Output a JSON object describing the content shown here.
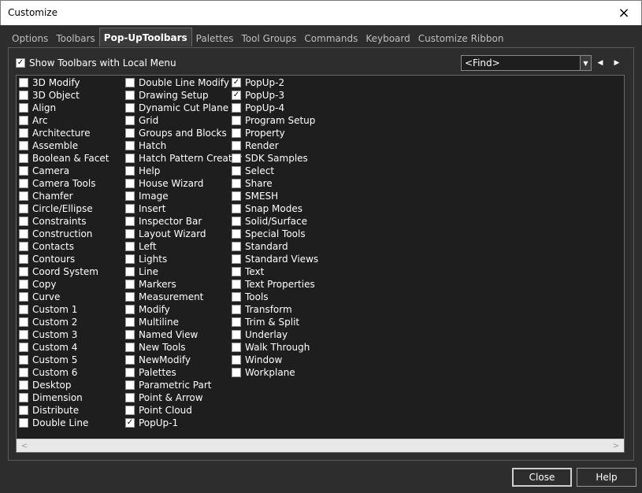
{
  "window": {
    "title": "Customize"
  },
  "tabs": [
    {
      "label": "Options",
      "active": false
    },
    {
      "label": "Toolbars",
      "active": false
    },
    {
      "label": "Pop-UpToolbars",
      "active": true
    },
    {
      "label": "Palettes",
      "active": false
    },
    {
      "label": "Tool Groups",
      "active": false
    },
    {
      "label": "Commands",
      "active": false
    },
    {
      "label": "Keyboard",
      "active": false
    },
    {
      "label": "Customize Ribbon",
      "active": false
    }
  ],
  "show_local_menu": {
    "label": "Show Toolbars with Local Menu",
    "checked": true
  },
  "find": {
    "value": "<Find>"
  },
  "columns": [
    [
      {
        "label": "3D Modify",
        "checked": false
      },
      {
        "label": "3D Object",
        "checked": false
      },
      {
        "label": "Align",
        "checked": false
      },
      {
        "label": "Arc",
        "checked": false
      },
      {
        "label": "Architecture",
        "checked": false
      },
      {
        "label": "Assemble",
        "checked": false
      },
      {
        "label": "Boolean & Facet",
        "checked": false
      },
      {
        "label": "Camera",
        "checked": false
      },
      {
        "label": "Camera Tools",
        "checked": false
      },
      {
        "label": "Chamfer",
        "checked": false
      },
      {
        "label": "Circle/Ellipse",
        "checked": false
      },
      {
        "label": "Constraints",
        "checked": false
      },
      {
        "label": "Construction",
        "checked": false
      },
      {
        "label": "Contacts",
        "checked": false
      },
      {
        "label": "Contours",
        "checked": false
      },
      {
        "label": "Coord System",
        "checked": false
      },
      {
        "label": "Copy",
        "checked": false
      },
      {
        "label": "Curve",
        "checked": false
      },
      {
        "label": "Custom 1",
        "checked": false
      },
      {
        "label": "Custom 2",
        "checked": false
      },
      {
        "label": "Custom 3",
        "checked": false
      },
      {
        "label": "Custom 4",
        "checked": false
      },
      {
        "label": "Custom 5",
        "checked": false
      },
      {
        "label": "Custom 6",
        "checked": false
      },
      {
        "label": "Desktop",
        "checked": false
      },
      {
        "label": "Dimension",
        "checked": false
      },
      {
        "label": "Distribute",
        "checked": false
      },
      {
        "label": "Double Line",
        "checked": false
      }
    ],
    [
      {
        "label": "Double Line Modify",
        "checked": false
      },
      {
        "label": "Drawing Setup",
        "checked": false
      },
      {
        "label": "Dynamic Cut Plane",
        "checked": false
      },
      {
        "label": "Grid",
        "checked": false
      },
      {
        "label": "Groups and Blocks",
        "checked": false
      },
      {
        "label": "Hatch",
        "checked": false
      },
      {
        "label": "Hatch Pattern Creator",
        "checked": false
      },
      {
        "label": "Help",
        "checked": false
      },
      {
        "label": "House Wizard",
        "checked": false
      },
      {
        "label": "Image",
        "checked": false
      },
      {
        "label": "Insert",
        "checked": false
      },
      {
        "label": "Inspector Bar",
        "checked": false
      },
      {
        "label": "Layout Wizard",
        "checked": false
      },
      {
        "label": "Left",
        "checked": false
      },
      {
        "label": "Lights",
        "checked": false
      },
      {
        "label": "Line",
        "checked": false
      },
      {
        "label": "Markers",
        "checked": false
      },
      {
        "label": "Measurement",
        "checked": false
      },
      {
        "label": "Modify",
        "checked": false
      },
      {
        "label": "Multiline",
        "checked": false
      },
      {
        "label": "Named View",
        "checked": false
      },
      {
        "label": "New Tools",
        "checked": false
      },
      {
        "label": "NewModify",
        "checked": false
      },
      {
        "label": "Palettes",
        "checked": false
      },
      {
        "label": "Parametric Part",
        "checked": false
      },
      {
        "label": "Point & Arrow",
        "checked": false
      },
      {
        "label": "Point Cloud",
        "checked": false
      },
      {
        "label": "PopUp-1",
        "checked": true
      }
    ],
    [
      {
        "label": "PopUp-2",
        "checked": true
      },
      {
        "label": "PopUp-3",
        "checked": true
      },
      {
        "label": "PopUp-4",
        "checked": false
      },
      {
        "label": "Program Setup",
        "checked": false
      },
      {
        "label": "Property",
        "checked": false
      },
      {
        "label": "Render",
        "checked": false
      },
      {
        "label": "SDK Samples",
        "checked": false
      },
      {
        "label": "Select",
        "checked": false
      },
      {
        "label": "Share",
        "checked": false
      },
      {
        "label": "SMESH",
        "checked": false
      },
      {
        "label": "Snap Modes",
        "checked": false
      },
      {
        "label": "Solid/Surface",
        "checked": false
      },
      {
        "label": "Special Tools",
        "checked": false
      },
      {
        "label": "Standard",
        "checked": false
      },
      {
        "label": "Standard Views",
        "checked": false
      },
      {
        "label": "Text",
        "checked": false
      },
      {
        "label": "Text Properties",
        "checked": false
      },
      {
        "label": "Tools",
        "checked": false
      },
      {
        "label": "Transform",
        "checked": false
      },
      {
        "label": "Trim & Split",
        "checked": false
      },
      {
        "label": "Underlay",
        "checked": false
      },
      {
        "label": "Walk Through",
        "checked": false
      },
      {
        "label": "Window",
        "checked": false
      },
      {
        "label": "Workplane",
        "checked": false
      }
    ]
  ],
  "buttons": {
    "close": "Close",
    "help": "Help"
  },
  "icons": {
    "close": "×",
    "dropdown": "▼",
    "prev": "◀",
    "next": "▶",
    "scroll_left": "<",
    "scroll_right": ">",
    "check": "✓"
  }
}
